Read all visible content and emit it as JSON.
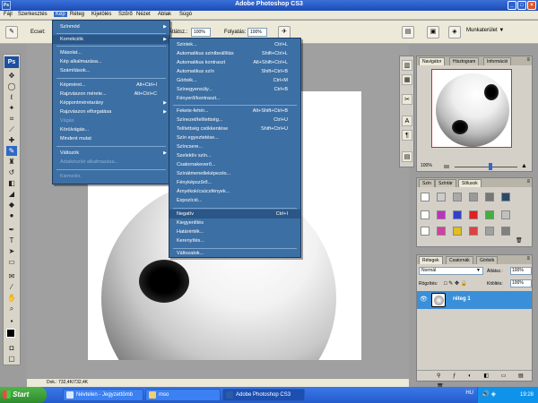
{
  "app": {
    "title": "Adobe Photoshop CS3",
    "icon_label": "Ps"
  },
  "menubar": [
    "Fájl",
    "Szerkesztés",
    "Kép",
    "Réteg",
    "Kijelölés",
    "Szűrő",
    "Nézet",
    "Ablak",
    "Súgó"
  ],
  "options_bar": {
    "brush_label": "Ecset:",
    "opacity_label": "Átlátsz.:",
    "opacity_value": "100%",
    "flow_label": "Folyatás:",
    "flow_value": "100%",
    "workspace_label": "Munkaterület"
  },
  "image_menu": {
    "items": [
      {
        "label": "Színmód",
        "shortcut": "",
        "submenu": true,
        "dim": false
      },
      {
        "label": "Korrekciók",
        "shortcut": "",
        "submenu": true,
        "dim": false,
        "highlighted": true
      },
      {
        "label": "Másolat...",
        "shortcut": "",
        "submenu": false,
        "dim": false
      },
      {
        "label": "Kép alkalmazása...",
        "shortcut": "",
        "submenu": false,
        "dim": false
      },
      {
        "label": "Számítások...",
        "shortcut": "",
        "submenu": false,
        "dim": false
      },
      {
        "label": "Képméret...",
        "shortcut": "Alt+Ctrl+I",
        "submenu": false,
        "dim": false
      },
      {
        "label": "Rajzvászon mérete...",
        "shortcut": "Alt+Ctrl+C",
        "submenu": false,
        "dim": false
      },
      {
        "label": "Képpontméretarány",
        "shortcut": "",
        "submenu": true,
        "dim": false
      },
      {
        "label": "Rajzvászon elforgatása",
        "shortcut": "",
        "submenu": true,
        "dim": false
      },
      {
        "label": "Vágás",
        "shortcut": "",
        "submenu": false,
        "dim": true
      },
      {
        "label": "Körülvágás...",
        "shortcut": "",
        "submenu": false,
        "dim": false
      },
      {
        "label": "Mindent mutat",
        "shortcut": "",
        "submenu": false,
        "dim": false
      },
      {
        "label": "Változók",
        "shortcut": "",
        "submenu": true,
        "dim": false
      },
      {
        "label": "Adatkészlet alkalmazása...",
        "shortcut": "",
        "submenu": false,
        "dim": true
      },
      {
        "label": "Kiemelés",
        "shortcut": "",
        "submenu": false,
        "dim": true
      }
    ]
  },
  "adjust_menu": {
    "items": [
      {
        "label": "Szintek...",
        "shortcut": "Ctrl+L"
      },
      {
        "label": "Automatikus szintbeállítás",
        "shortcut": "Shift+Ctrl+L"
      },
      {
        "label": "Automatikus kontraszt",
        "shortcut": "Alt+Shift+Ctrl+L"
      },
      {
        "label": "Automatikus szín",
        "shortcut": "Shift+Ctrl+B"
      },
      {
        "label": "Görbék...",
        "shortcut": "Ctrl+M"
      },
      {
        "label": "Színegyensúly...",
        "shortcut": "Ctrl+B"
      },
      {
        "label": "Fényerő/kontraszt...",
        "shortcut": ""
      },
      {
        "label": "Fekete-fehér...",
        "shortcut": "Alt+Shift+Ctrl+B"
      },
      {
        "label": "Színezet/telítettség...",
        "shortcut": "Ctrl+U"
      },
      {
        "label": "Telítettség csökkentése",
        "shortcut": "Shift+Ctrl+U"
      },
      {
        "label": "Szín egyeztetése...",
        "shortcut": ""
      },
      {
        "label": "Színcsere...",
        "shortcut": ""
      },
      {
        "label": "Szelektív szín...",
        "shortcut": ""
      },
      {
        "label": "Csatornakeverő...",
        "shortcut": ""
      },
      {
        "label": "Színátmenetleképezés...",
        "shortcut": ""
      },
      {
        "label": "Fényképszűrő...",
        "shortcut": ""
      },
      {
        "label": "Árnyékok/csúcsfények...",
        "shortcut": ""
      },
      {
        "label": "Expozíció...",
        "shortcut": ""
      },
      {
        "label": "Negatív",
        "shortcut": "Ctrl+I",
        "highlighted": true
      },
      {
        "label": "Kiegyenlítés",
        "shortcut": ""
      },
      {
        "label": "Határérték...",
        "shortcut": ""
      },
      {
        "label": "Kerenyítés...",
        "shortcut": ""
      },
      {
        "label": "Változatok...",
        "shortcut": ""
      }
    ]
  },
  "document": {
    "status": "Dok.: 732,4K/732,4K"
  },
  "navigator": {
    "tabs": [
      "Navigátor",
      "Hisztogram",
      "Információ"
    ],
    "zoom": "100%"
  },
  "styles_panel": {
    "tabs": [
      "Szín",
      "Színtár",
      "Stílusok"
    ]
  },
  "layers_panel": {
    "tabs": [
      "Rétegek",
      "Csatornák",
      "Görbék"
    ],
    "blend_mode": "Normál",
    "opacity_label": "Átlátsz.:",
    "opacity_value": "100%",
    "lock_label": "Rögzítés:",
    "fill_label": "Kitöltés:",
    "fill_value": "100%",
    "layer_name": "réteg 1"
  },
  "taskbar": {
    "start": "Start",
    "tasks": [
      "Névtelen - Jegyzettömb",
      "mso",
      "Adobe Photoshop CS3"
    ],
    "lang": "HU",
    "clock": "19:28"
  }
}
